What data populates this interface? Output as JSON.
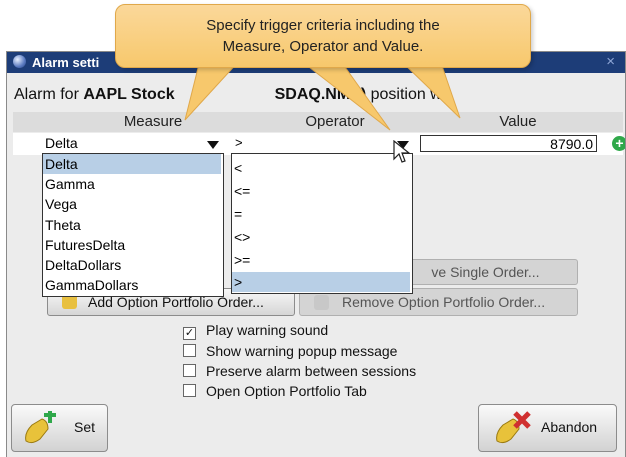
{
  "callout": {
    "line1": "Specify trigger criteria including the",
    "line2": "Measure, Operator and Value."
  },
  "window": {
    "title": "Alarm setti",
    "close": "×"
  },
  "alarm": {
    "prefix": "Alarm for ",
    "symbol": "AAPL Stock",
    "exchange": "SDAQ.NMS)",
    "suffix": " position w"
  },
  "columns": {
    "measure": "Measure",
    "operator": "Operator",
    "value": "Value"
  },
  "row": {
    "measure": "Delta",
    "operator": ">",
    "value": "8790.0"
  },
  "measure_options": [
    "Delta",
    "Gamma",
    "Vega",
    "Theta",
    "FuturesDelta",
    "DeltaDollars",
    "GammaDollars"
  ],
  "operator_options": [
    "<",
    "<=",
    "=",
    "<>",
    ">=",
    ">"
  ],
  "buttons": {
    "remove_single_order": "ve Single Order...",
    "add_option_portfolio_order": "Add Option Portfolio Order...",
    "remove_option_portfolio_order": "Remove Option Portfolio Order...",
    "set": "Set",
    "abandon": "Abandon"
  },
  "options": [
    {
      "label": "Play warning sound",
      "checked": true
    },
    {
      "label": "Show warning popup message",
      "checked": false
    },
    {
      "label": "Preserve alarm between sessions",
      "checked": false
    },
    {
      "label": "Open Option Portfolio Tab",
      "checked": false
    }
  ],
  "colors": {
    "titlebar": "#1d3d78",
    "callout": "#f7c86c",
    "selection": "#b8cfe6",
    "add_green": "#2fa84a"
  }
}
